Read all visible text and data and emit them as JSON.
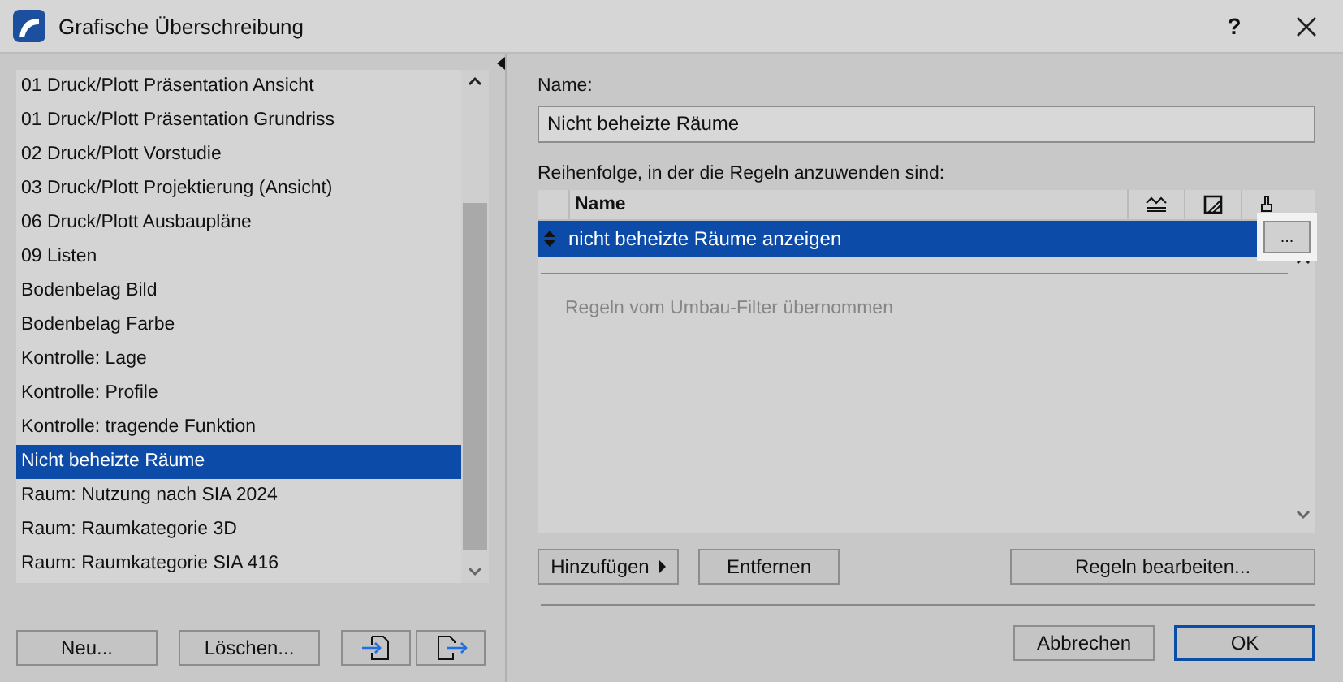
{
  "window": {
    "title": "Grafische Überschreibung",
    "help": "?"
  },
  "overrides": {
    "items": [
      {
        "label": "01 Druck/Plott Präsentation Ansicht",
        "selected": false
      },
      {
        "label": "01 Druck/Plott Präsentation Grundriss",
        "selected": false
      },
      {
        "label": "02 Druck/Plott Vorstudie",
        "selected": false
      },
      {
        "label": "03 Druck/Plott Projektierung (Ansicht)",
        "selected": false
      },
      {
        "label": "06 Druck/Plott Ausbaupläne",
        "selected": false
      },
      {
        "label": "09 Listen",
        "selected": false
      },
      {
        "label": "Bodenbelag Bild",
        "selected": false
      },
      {
        "label": "Bodenbelag Farbe",
        "selected": false
      },
      {
        "label": "Kontrolle: Lage",
        "selected": false
      },
      {
        "label": "Kontrolle: Profile",
        "selected": false
      },
      {
        "label": "Kontrolle: tragende Funktion",
        "selected": false
      },
      {
        "label": "Nicht beheizte Räume",
        "selected": true
      },
      {
        "label": "Raum: Nutzung nach SIA 2024",
        "selected": false
      },
      {
        "label": "Raum: Raumkategorie 3D",
        "selected": false
      },
      {
        "label": "Raum: Raumkategorie SIA 416",
        "selected": false
      }
    ],
    "buttons": [
      "Neu...",
      "Löschen..."
    ]
  },
  "name_label": "Name:",
  "name_value": "Nicht beheizte Räume",
  "rules_label": "Reihenfolge, in der die Regeln anzuwenden sind:",
  "rules": {
    "columns": [
      "Name"
    ],
    "rows": [
      {
        "name": "nicht beheizte Räume anzeigen",
        "selected": true,
        "action": "..."
      }
    ],
    "inherited_note": "Regeln vom Umbau-Filter übernommen"
  },
  "rule_buttons": {
    "add": "Hinzufügen",
    "remove": "Entfernen",
    "edit": "Regeln bearbeiten..."
  },
  "footer": {
    "cancel": "Abbrechen",
    "ok": "OK"
  }
}
